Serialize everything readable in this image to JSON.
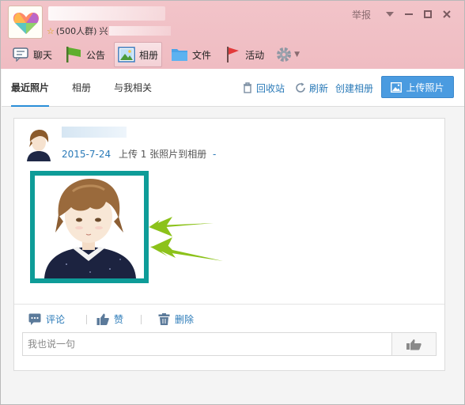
{
  "group": {
    "member_count": "(500人群)",
    "info_suffix": "兴"
  },
  "window_controls": {
    "report_label": "举报"
  },
  "tabs": [
    {
      "label": "聊天",
      "icon": "chat-icon"
    },
    {
      "label": "公告",
      "icon": "announcement-flag-icon"
    },
    {
      "label": "相册",
      "icon": "album-photo-icon",
      "active": true
    },
    {
      "label": "文件",
      "icon": "folder-icon"
    },
    {
      "label": "活动",
      "icon": "event-flag-icon"
    }
  ],
  "album_nav": {
    "tabs": [
      "最近照片",
      "相册",
      "与我相关"
    ],
    "active_tab": "最近照片",
    "recycle_label": "回收站",
    "refresh_label": "刷新",
    "create_album_label": "创建相册",
    "upload_label": "上传照片"
  },
  "post": {
    "date": "2015-7-24",
    "text": "上传 1 张照片到相册",
    "dash": "-",
    "actions": {
      "comment_label": "评论",
      "like_label": "赞",
      "delete_label": "删除"
    },
    "comment_placeholder": "我也说一句"
  },
  "colors": {
    "title_bar": "#efbcc2",
    "accent_blue": "#4a9be0",
    "link_blue": "#2a7ab8",
    "photo_frame": "#0e9c98",
    "arrow_green": "#8cc21a"
  }
}
